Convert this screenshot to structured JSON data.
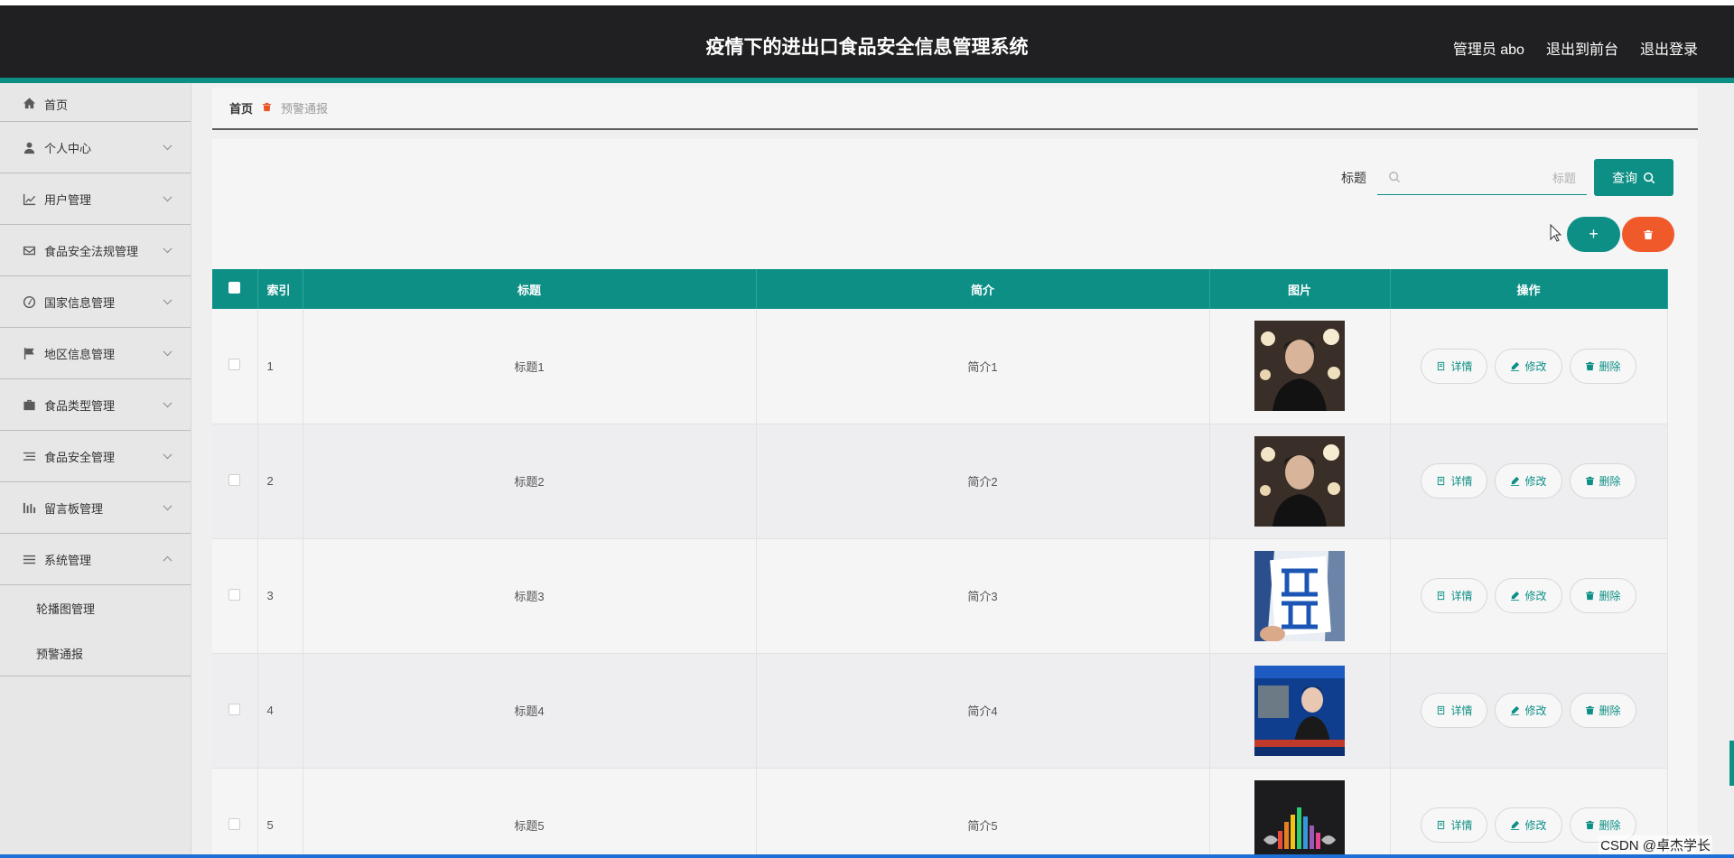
{
  "header": {
    "title": "疫情下的进出口食品安全信息管理系统",
    "admin": "管理员 abo",
    "front_link": "退出到前台",
    "logout_link": "退出登录"
  },
  "sidebar": {
    "items": [
      {
        "label": "首页",
        "icon": "home-icon"
      },
      {
        "label": "个人中心",
        "icon": "user-icon"
      },
      {
        "label": "用户管理",
        "icon": "chart-icon"
      },
      {
        "label": "食品安全法规管理",
        "icon": "mail-icon"
      },
      {
        "label": "国家信息管理",
        "icon": "gauge-icon"
      },
      {
        "label": "地区信息管理",
        "icon": "flag-icon"
      },
      {
        "label": "食品类型管理",
        "icon": "briefcase-icon"
      },
      {
        "label": "食品安全管理",
        "icon": "list-icon"
      },
      {
        "label": "留言板管理",
        "icon": "bars-icon"
      },
      {
        "label": "系统管理",
        "icon": "menu-icon"
      }
    ],
    "sub_items": [
      "轮播图管理",
      "预警通报"
    ]
  },
  "breadcrumb": {
    "home": "首页",
    "current": "预警通报"
  },
  "search": {
    "label": "标题",
    "placeholder": "标题",
    "button": "查询"
  },
  "table": {
    "headers": {
      "index": "索引",
      "title": "标题",
      "intro": "简介",
      "image": "图片",
      "ops": "操作"
    },
    "rows": [
      {
        "index": "1",
        "title": "标题1",
        "intro": "简介1"
      },
      {
        "index": "2",
        "title": "标题2",
        "intro": "简介2"
      },
      {
        "index": "3",
        "title": "标题3",
        "intro": "简介3"
      },
      {
        "index": "4",
        "title": "标题4",
        "intro": "简介4"
      },
      {
        "index": "5",
        "title": "标题5",
        "intro": "简介5"
      }
    ],
    "op_labels": {
      "detail": "详情",
      "edit": "修改",
      "delete": "删除"
    }
  },
  "watermark": "CSDN @卓杰学长",
  "colors": {
    "accent": "#0e8f86",
    "danger": "#f05a2a",
    "header_bg": "#202022"
  }
}
